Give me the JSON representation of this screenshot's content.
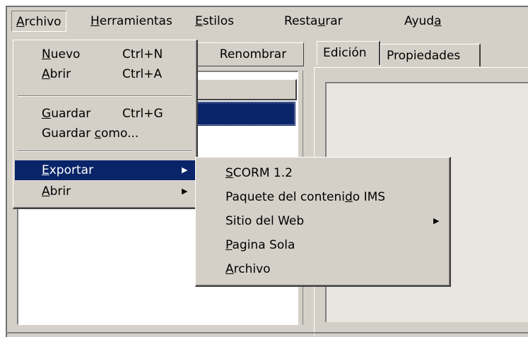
{
  "menubar": {
    "archivo": "rchivo",
    "archivo_key": "A",
    "herramientas": "erramientas",
    "herramientas_key": "H",
    "estilos": "stilos",
    "estilos_key": "E",
    "restaurar_pre": "Resta",
    "restaurar_key": "u",
    "restaurar_post": "rar",
    "ayuda_pre": "Ayud",
    "ayuda_key": "a"
  },
  "toolbar": {
    "renombrar": "Renombrar"
  },
  "tabs": [
    {
      "label": "Edición"
    },
    {
      "label": "Propiedades"
    }
  ],
  "file_menu": {
    "nuevo_key": "N",
    "nuevo": "uevo",
    "nuevo_shortcut": "Ctrl+N",
    "abrir_key": "A",
    "abrir": "brir",
    "abrir_shortcut": "Ctrl+A",
    "guardar_key": "G",
    "guardar": "uardar",
    "guardar_shortcut": "Ctrl+G",
    "guardar_como_pre": "Guardar ",
    "guardar_como_key": "c",
    "guardar_como_post": "omo...",
    "exportar_key": "E",
    "exportar": "xportar",
    "abrir_sub_key": "A",
    "abrir_sub": "brir"
  },
  "export_menu": {
    "scorm_key": "S",
    "scorm": "CORM 1.2",
    "ims_pre": "Paquete del conteni",
    "ims_key": "d",
    "ims_post": "o IMS",
    "web": "Sitio del Web",
    "pagina_key": "P",
    "pagina": "agina Sola",
    "archivo_key": "A",
    "archivo": "rchivo"
  },
  "colors": {
    "face": "#d4d0c8",
    "highlight": "#0a246a",
    "shadow": "#808080",
    "dark_shadow": "#404040"
  }
}
